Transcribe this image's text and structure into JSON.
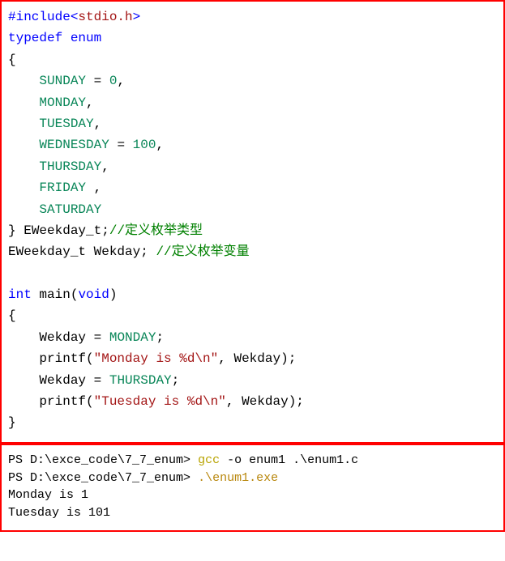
{
  "code": {
    "include_kw": "#include",
    "angle_open": "<",
    "header": "stdio.h",
    "angle_close": ">",
    "typedef": "typedef",
    "enum": "enum",
    "brace_open": "{",
    "sunday": "SUNDAY",
    "zero": "0",
    "monday": "MONDAY",
    "tuesday": "TUESDAY",
    "wednesday": "WEDNESDAY",
    "hundred": "100",
    "thursday": "THURSDAY",
    "friday": "FRIDAY",
    "saturday": "SATURDAY",
    "brace_close": "}",
    "typedef_name": "EWeekday_t",
    "cmt1": "//定义枚举类型",
    "decl_type": "EWeekday_t",
    "decl_var": "Wekday",
    "cmt2": "//定义枚举变量",
    "int": "int",
    "main": "main",
    "void": "void",
    "assign1_lhs": "Wekday",
    "assign1_rhs": "MONDAY",
    "printf": "printf",
    "str1": "\"Monday is %d\\n\"",
    "printf_arg": "Wekday",
    "assign2_lhs": "Wekday",
    "assign2_rhs": "THURSDAY",
    "str2": "\"Tuesday is %d\\n\"",
    "printf_arg2": "Wekday"
  },
  "term": {
    "prompt1_a": "PS ",
    "prompt1_b": "D:\\exce_code\\7_7_enum>",
    "cmd1": "gcc",
    "cmd1_args": "-o enum1 .\\enum1.c",
    "prompt2_a": "PS ",
    "prompt2_b": "D:\\exce_code\\7_7_enum>",
    "cmd2": ".\\enum1.exe",
    "out1": "Monday is 1",
    "out2": "Tuesday is 101"
  }
}
